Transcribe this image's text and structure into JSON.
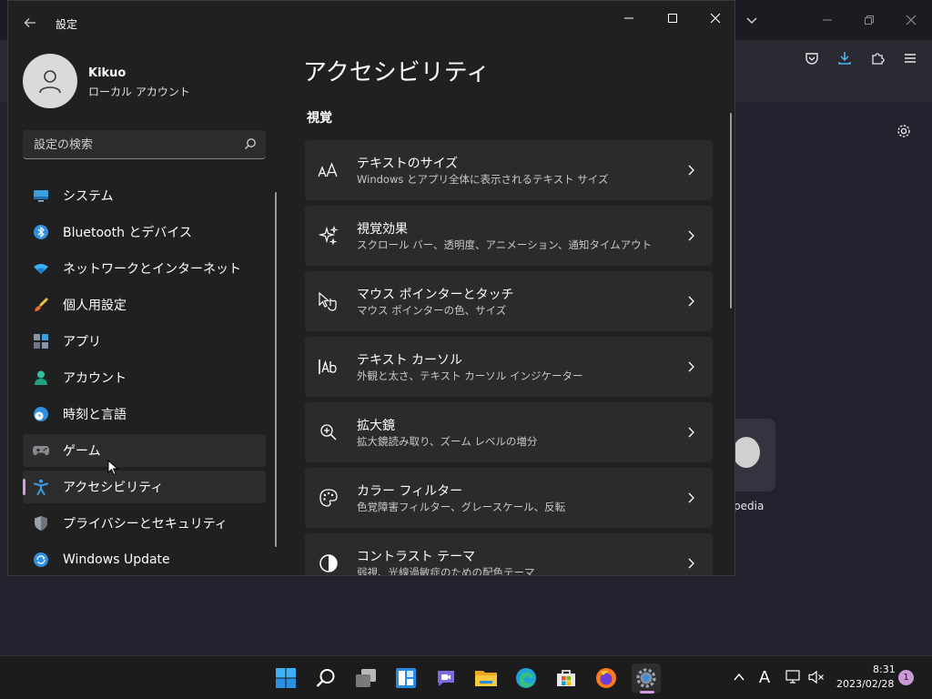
{
  "settings": {
    "title": "設定",
    "user": {
      "name": "Kikuo",
      "account_type": "ローカル アカウント"
    },
    "search": {
      "placeholder": "設定の検索"
    },
    "nav": [
      {
        "label": "システム",
        "icon": "monitor-icon"
      },
      {
        "label": "Bluetooth とデバイス",
        "icon": "bluetooth-icon"
      },
      {
        "label": "ネットワークとインターネット",
        "icon": "wifi-icon"
      },
      {
        "label": "個人用設定",
        "icon": "brush-icon"
      },
      {
        "label": "アプリ",
        "icon": "apps-icon"
      },
      {
        "label": "アカウント",
        "icon": "person-icon"
      },
      {
        "label": "時刻と言語",
        "icon": "globe-clock-icon"
      },
      {
        "label": "ゲーム",
        "icon": "gamepad-icon"
      },
      {
        "label": "アクセシビリティ",
        "icon": "accessibility-icon",
        "selected": true
      },
      {
        "label": "プライバシーとセキュリティ",
        "icon": "shield-icon"
      },
      {
        "label": "Windows Update",
        "icon": "update-icon"
      }
    ],
    "page_title": "アクセシビリティ",
    "section_title": "視覚",
    "cards": [
      {
        "title": "テキストのサイズ",
        "subtitle": "Windows とアプリ全体に表示されるテキスト サイズ",
        "icon": "text-size-icon"
      },
      {
        "title": "視覚効果",
        "subtitle": "スクロール バー、透明度、アニメーション、通知タイムアウト",
        "icon": "sparkle-icon"
      },
      {
        "title": "マウス ポインターとタッチ",
        "subtitle": "マウス ポインターの色、サイズ",
        "icon": "pointer-touch-icon"
      },
      {
        "title": "テキスト カーソル",
        "subtitle": "外観と太さ、テキスト カーソル インジケーター",
        "icon": "text-cursor-icon"
      },
      {
        "title": "拡大鏡",
        "subtitle": "拡大鏡読み取り、ズーム レベルの増分",
        "icon": "magnifier-icon"
      },
      {
        "title": "カラー フィルター",
        "subtitle": "色覚障害フィルター、グレースケール、反転",
        "icon": "palette-icon"
      },
      {
        "title": "コントラスト テーマ",
        "subtitle": "弱視、光線過敏症のための配色テーマ",
        "icon": "contrast-icon"
      }
    ]
  },
  "browser": {
    "tile_label": "pedia"
  },
  "taskbar": {
    "time": "8:31",
    "date": "2023/02/28",
    "notification_count": "1",
    "ime_indicator": "A",
    "pinned": [
      "start-icon",
      "search-icon",
      "task-view-icon",
      "widgets-icon",
      "teams-chat-icon",
      "file-explorer-icon",
      "edge-icon",
      "store-icon",
      "firefox-icon",
      "settings-icon"
    ]
  },
  "colors": {
    "accent": "#d59be0",
    "window_bg": "#202020",
    "card_bg": "#2b2b2b",
    "taskbar_bg": "#1c1c1c"
  }
}
